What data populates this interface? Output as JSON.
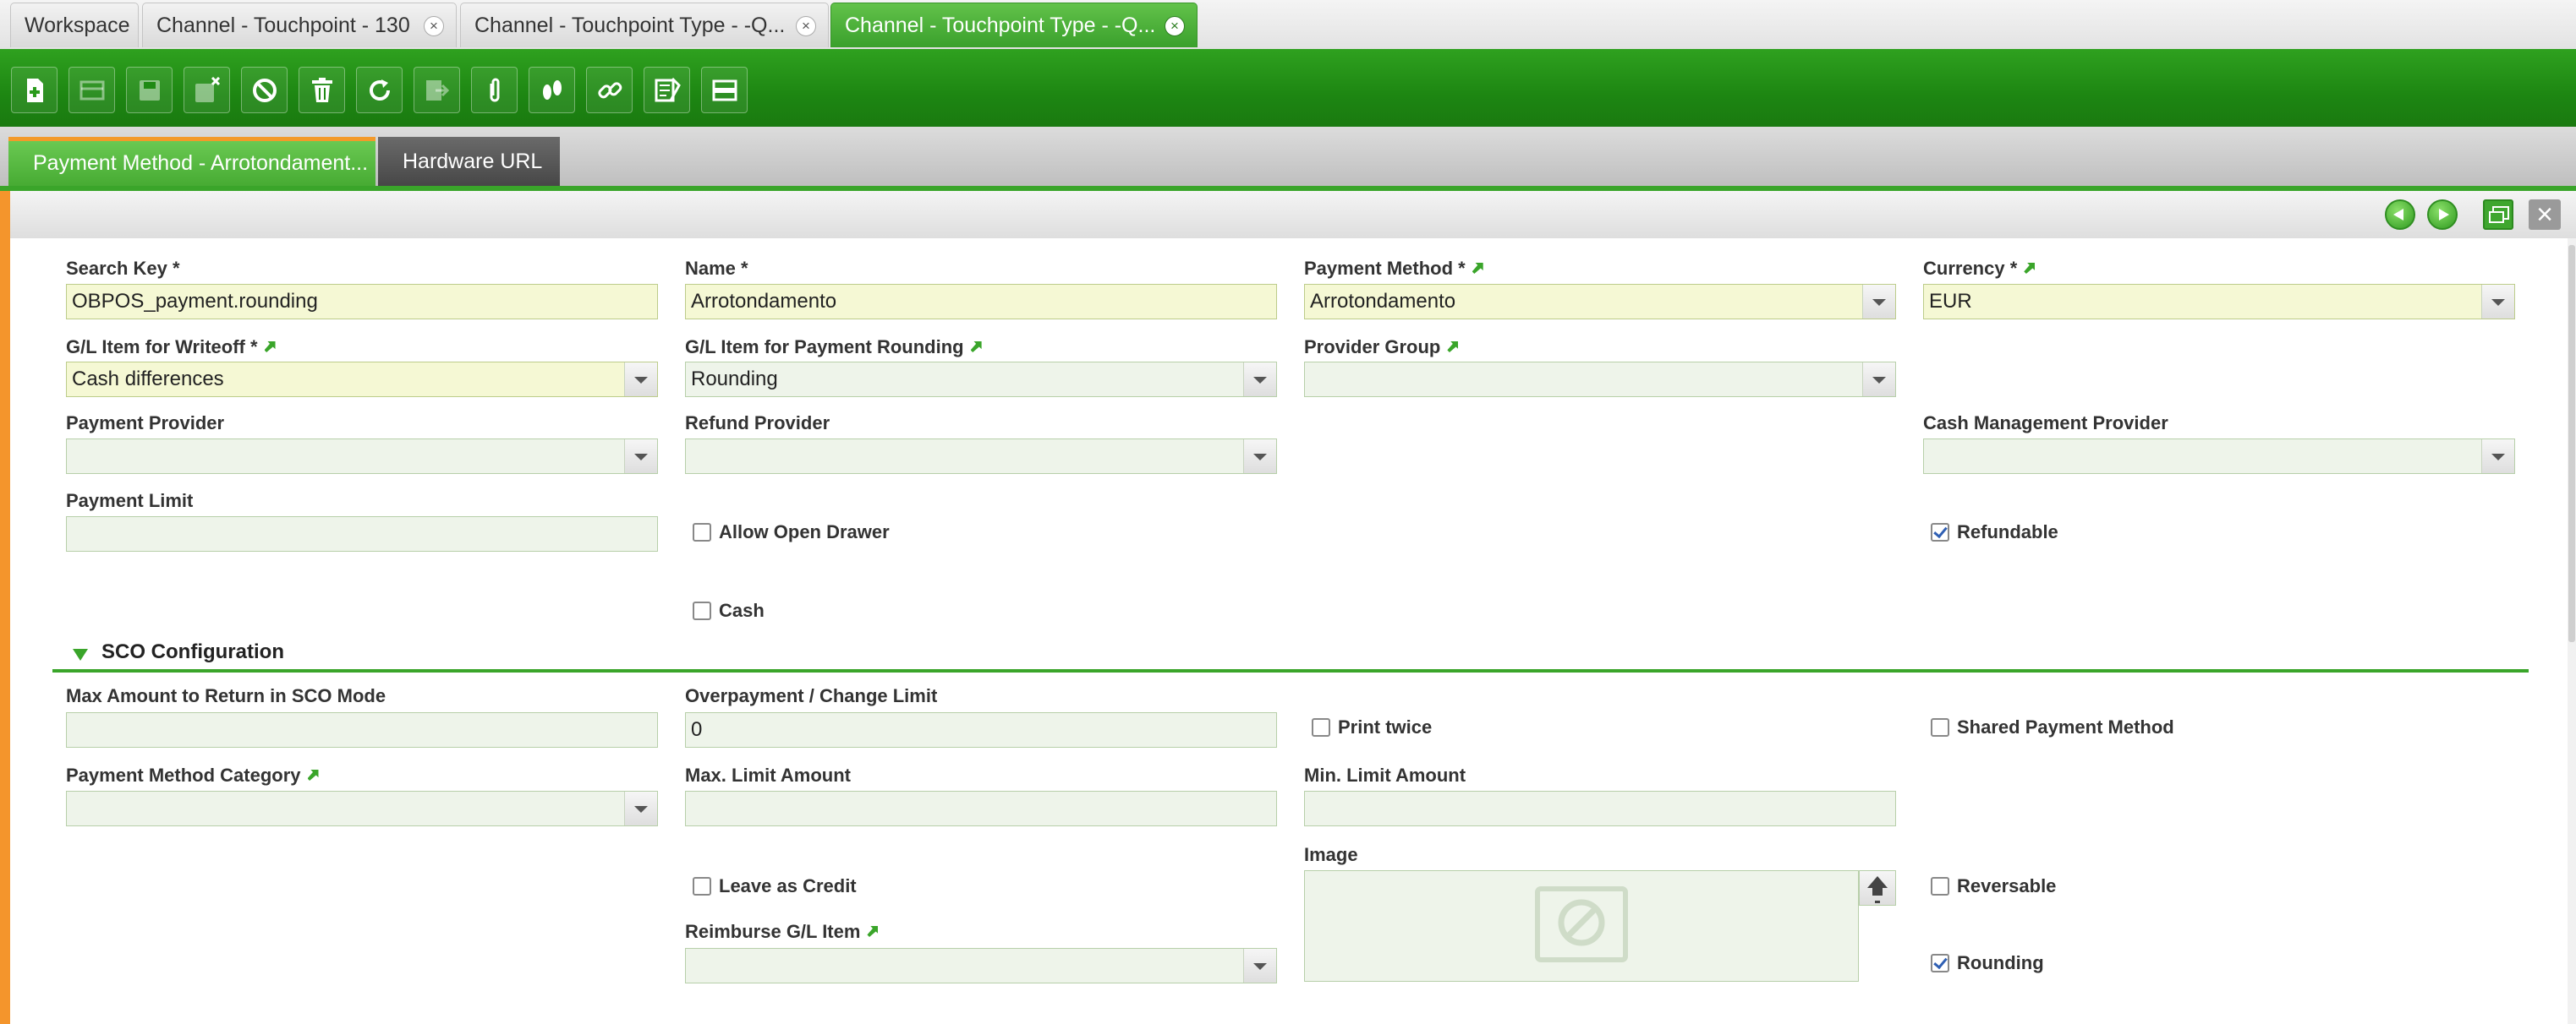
{
  "window_tabs": [
    {
      "label": "Workspace",
      "closable": false
    },
    {
      "label": "Channel - Touchpoint - 130",
      "closable": true
    },
    {
      "label": "Channel - Touchpoint Type - -Q...",
      "closable": true
    },
    {
      "label": "Channel - Touchpoint Type - -Q...",
      "closable": true,
      "active": true
    }
  ],
  "close_glyph": "×",
  "toolbar": {
    "buttons": [
      {
        "icon": "new-document-icon",
        "enabled": true
      },
      {
        "icon": "new-row-icon",
        "enabled": false
      },
      {
        "icon": "save-icon",
        "enabled": false
      },
      {
        "icon": "save-close-icon",
        "enabled": false
      },
      {
        "icon": "undo-cancel-icon",
        "enabled": true
      },
      {
        "icon": "delete-trash-icon",
        "enabled": true
      },
      {
        "icon": "refresh-icon",
        "enabled": true
      },
      {
        "icon": "export-icon",
        "enabled": false
      },
      {
        "icon": "attachment-icon",
        "enabled": true
      },
      {
        "icon": "audit-trail-footprints-icon",
        "enabled": true
      },
      {
        "icon": "link-icon",
        "enabled": true
      },
      {
        "icon": "process-tools-icon",
        "enabled": true
      },
      {
        "icon": "layout-toggle-icon",
        "enabled": true
      }
    ]
  },
  "form_tabs": [
    {
      "label": "Payment Method - Arrotondament...",
      "active": true
    },
    {
      "label": "Hardware URL",
      "active": false
    }
  ],
  "colors": {
    "accent_green": "#3aa52a",
    "required_field_bg": "#f5f8d4",
    "field_bg": "#eef4ea",
    "left_stripe_orange": "#f4952c"
  },
  "form": {
    "search_key": {
      "label": "Search Key *",
      "value": "OBPOS_payment.rounding"
    },
    "name": {
      "label": "Name *",
      "value": "Arrotondamento"
    },
    "payment_method": {
      "label": "Payment Method *",
      "value": "Arrotondamento"
    },
    "currency": {
      "label": "Currency *",
      "value": "EUR"
    },
    "gl_writeoff": {
      "label": "G/L Item for Writeoff *",
      "value": "Cash differences"
    },
    "gl_rounding": {
      "label": "G/L Item for Payment Rounding",
      "value": "Rounding"
    },
    "provider_group": {
      "label": "Provider Group",
      "value": ""
    },
    "payment_provider": {
      "label": "Payment Provider",
      "value": ""
    },
    "refund_provider": {
      "label": "Refund Provider",
      "value": ""
    },
    "cash_mgmt_provider": {
      "label": "Cash Management Provider",
      "value": ""
    },
    "payment_limit": {
      "label": "Payment Limit",
      "value": ""
    },
    "allow_open_drawer": {
      "label": "Allow Open Drawer",
      "checked": false
    },
    "refundable": {
      "label": "Refundable",
      "checked": true
    },
    "cash": {
      "label": "Cash",
      "checked": false
    }
  },
  "sco": {
    "title": "SCO Configuration",
    "max_return": {
      "label": "Max Amount to Return in SCO Mode",
      "value": ""
    },
    "overpayment": {
      "label": "Overpayment / Change Limit",
      "value": "0"
    },
    "print_twice": {
      "label": "Print twice",
      "checked": false
    },
    "shared_payment": {
      "label": "Shared Payment Method",
      "checked": false
    },
    "pm_category": {
      "label": "Payment Method Category",
      "value": ""
    },
    "max_limit": {
      "label": "Max. Limit Amount",
      "value": ""
    },
    "min_limit": {
      "label": "Min. Limit Amount",
      "value": ""
    },
    "image": {
      "label": "Image"
    },
    "leave_as_credit": {
      "label": "Leave as Credit",
      "checked": false
    },
    "reversable": {
      "label": "Reversable",
      "checked": false
    },
    "reimburse_gl": {
      "label": "Reimburse G/L Item",
      "value": ""
    },
    "rounding": {
      "label": "Rounding",
      "checked": true
    }
  }
}
